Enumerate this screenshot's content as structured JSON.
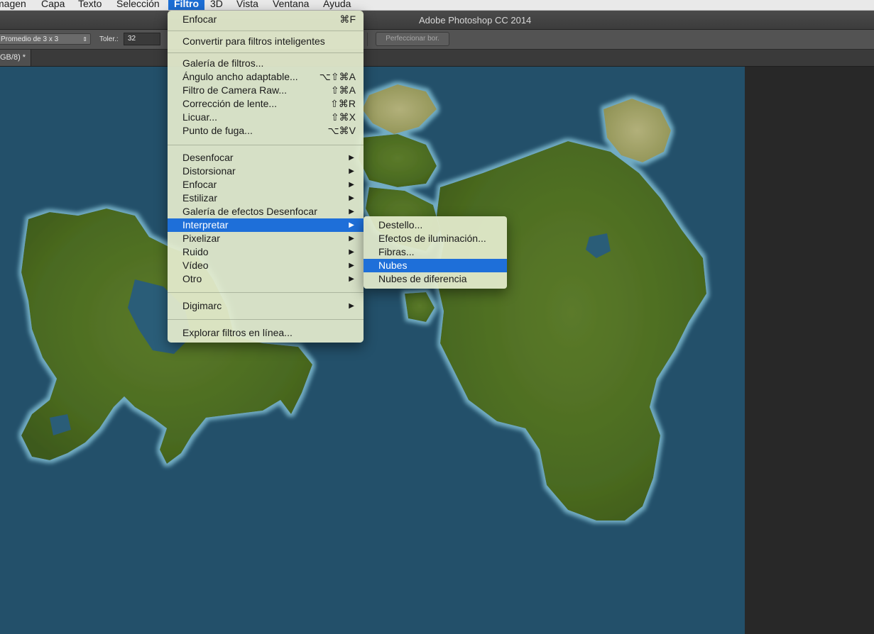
{
  "menubar": {
    "items": [
      "magen",
      "Capa",
      "Texto",
      "Selección",
      "Filtro",
      "3D",
      "Vista",
      "Ventana",
      "Ayuda"
    ],
    "active": "Filtro"
  },
  "titlebar": {
    "title": "Adobe Photoshop CC 2014"
  },
  "options": {
    "sample_size": "Promedio de 3 x 3",
    "tolerance_label": "Toler.:",
    "tolerance_value": "32",
    "refine_label": "Perfeccionar bor."
  },
  "document": {
    "tab_label": "GB/8) *"
  },
  "filter_menu": {
    "items": [
      {
        "label": "Enfocar",
        "shortcut": "⌘F"
      },
      {
        "label": "Convertir para filtros inteligentes"
      },
      {
        "label": "Galería de filtros..."
      },
      {
        "label": "Ángulo ancho adaptable...",
        "shortcut": "⌥⇧⌘A"
      },
      {
        "label": "Filtro de Camera Raw...",
        "shortcut": "⇧⌘A"
      },
      {
        "label": "Corrección de lente...",
        "shortcut": "⇧⌘R"
      },
      {
        "label": "Licuar...",
        "shortcut": "⇧⌘X"
      },
      {
        "label": "Punto de fuga...",
        "shortcut": "⌥⌘V"
      },
      {
        "label": "Desenfocar",
        "submenu": "▶"
      },
      {
        "label": "Distorsionar",
        "submenu": "▶"
      },
      {
        "label": "Enfocar",
        "submenu": "▶"
      },
      {
        "label": "Estilizar",
        "submenu": "▶"
      },
      {
        "label": "Galería de efectos Desenfocar",
        "submenu": "▶"
      },
      {
        "label": "Interpretar",
        "submenu": "▶"
      },
      {
        "label": "Pixelizar",
        "submenu": "▶"
      },
      {
        "label": "Ruido",
        "submenu": "▶"
      },
      {
        "label": "Vídeo",
        "submenu": "▶"
      },
      {
        "label": "Otro",
        "submenu": "▶"
      },
      {
        "label": "Digimarc",
        "submenu": "▶"
      },
      {
        "label": "Explorar filtros en línea..."
      }
    ]
  },
  "render_submenu": {
    "items": [
      "Destello...",
      "Efectos de iluminación...",
      "Fibras...",
      "Nubes",
      "Nubes de diferencia"
    ],
    "highlighted": "Nubes"
  },
  "colors": {
    "accent": "#1e6fd9",
    "ocean": "#23506a",
    "land": "#4f6f23"
  }
}
